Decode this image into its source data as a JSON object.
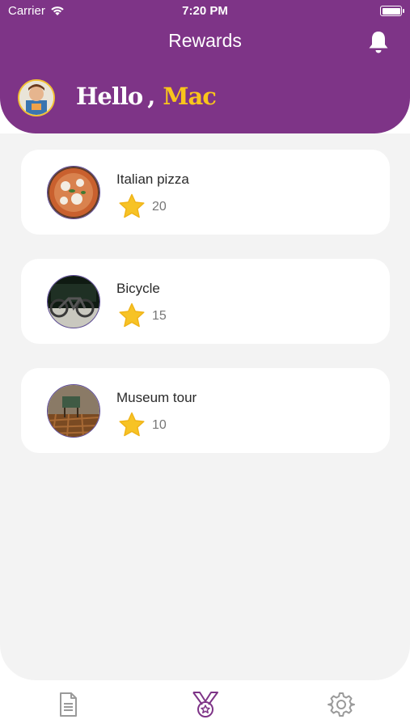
{
  "status_bar": {
    "carrier": "Carrier",
    "time": "7:20 PM"
  },
  "header": {
    "title": "Rewards",
    "greeting_hello": "Hello",
    "greeting_comma": ",",
    "user_name": "Mac"
  },
  "rewards": [
    {
      "title": "Italian pizza",
      "points": "20",
      "image": "pizza"
    },
    {
      "title": "Bicycle",
      "points": "15",
      "image": "bicycle"
    },
    {
      "title": "Museum tour",
      "points": "10",
      "image": "museum"
    }
  ],
  "tabbar": {
    "items": [
      "document-icon",
      "medal-icon",
      "gear-icon"
    ],
    "active_color": "#7e3487",
    "inactive_color": "#9a9a9a"
  },
  "colors": {
    "primary": "#7e3487",
    "accent": "#f9c51b",
    "background": "#f3f3f3"
  }
}
